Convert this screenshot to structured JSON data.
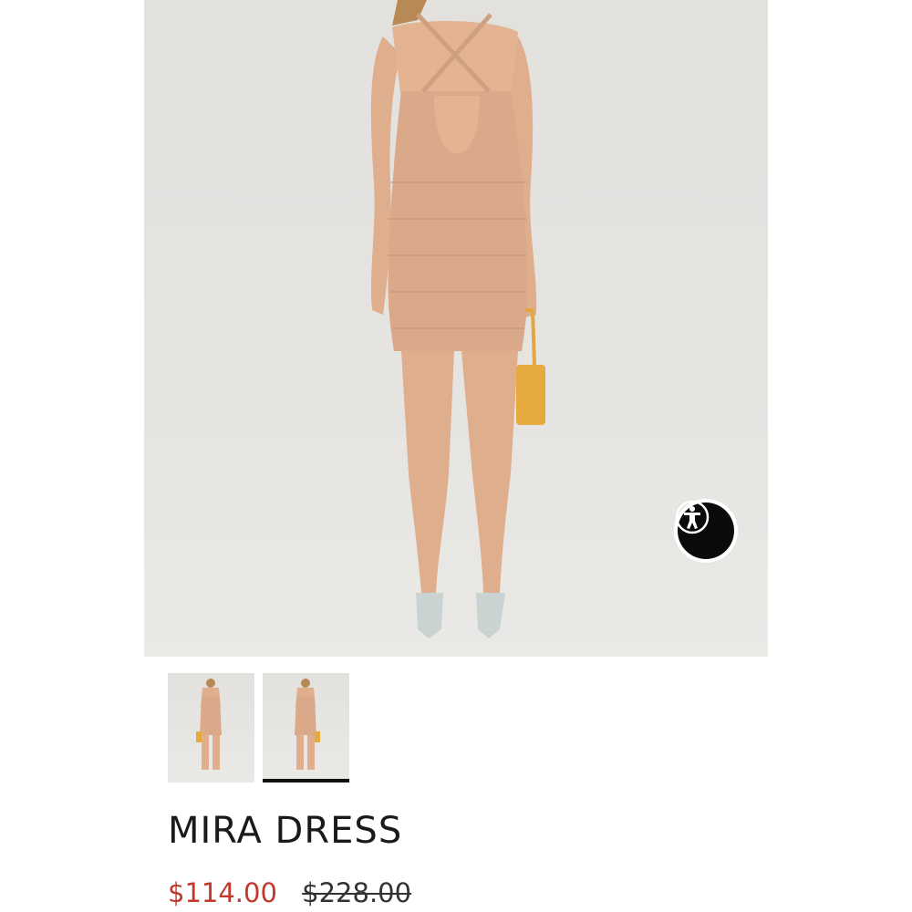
{
  "product": {
    "title": "MIRA DRESS",
    "sale_price": "$114.00",
    "original_price": "$228.00"
  },
  "gallery": {
    "thumbnails": [
      {
        "view": "front",
        "selected": false
      },
      {
        "view": "back",
        "selected": true
      }
    ]
  },
  "colors": {
    "background": "#e5e3e0",
    "dress": "#d9a98a",
    "sale_price": "#c0392b",
    "accessibility_button": "#0b0b0b"
  },
  "icons": {
    "accessibility": "accessibility-person-icon"
  }
}
